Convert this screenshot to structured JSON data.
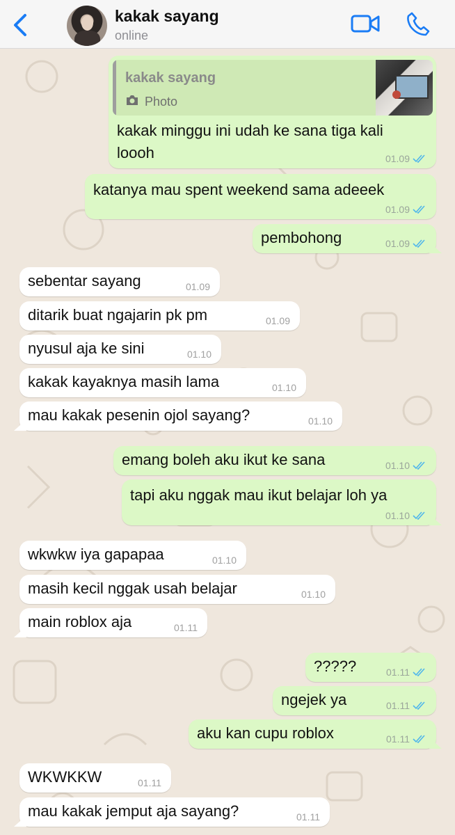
{
  "header": {
    "contact_name": "kakak sayang",
    "status": "online",
    "icons": [
      "back-chevron-icon",
      "video-call-icon",
      "phone-call-icon"
    ],
    "accent_color": "#1a7cf5"
  },
  "quoted": {
    "name": "kakak sayang",
    "type_label": "Photo"
  },
  "messages": [
    {
      "dir": "out",
      "text": "kakak minggu ini udah ke sana tiga kali",
      "text2": "loooh",
      "time": "01.09",
      "read": true,
      "reply_to": "photo"
    },
    {
      "dir": "out",
      "text": "katanya mau spent weekend sama adeeek",
      "time": "01.09",
      "read": true
    },
    {
      "dir": "out",
      "text": "pembohong",
      "time": "01.09",
      "read": true
    },
    {
      "dir": "in",
      "text": "sebentar sayang",
      "time": "01.09"
    },
    {
      "dir": "in",
      "text": "ditarik buat ngajarin pk pm",
      "time": "01.09"
    },
    {
      "dir": "in",
      "text": "nyusul aja ke sini",
      "time": "01.10"
    },
    {
      "dir": "in",
      "text": "kakak kayaknya masih lama",
      "time": "01.10"
    },
    {
      "dir": "in",
      "text": "mau kakak pesenin ojol sayang?",
      "time": "01.10"
    },
    {
      "dir": "out",
      "text": "emang boleh aku ikut ke sana",
      "time": "01.10",
      "read": true
    },
    {
      "dir": "out",
      "text": "tapi aku nggak mau ikut belajar loh ya",
      "time": "01.10",
      "read": true
    },
    {
      "dir": "in",
      "text": "wkwkw iya gapapaa",
      "time": "01.10"
    },
    {
      "dir": "in",
      "text": "masih kecil nggak usah belajar",
      "time": "01.10"
    },
    {
      "dir": "in",
      "text": "main roblox aja",
      "time": "01.11"
    },
    {
      "dir": "out",
      "text": "?????",
      "time": "01.11",
      "read": true
    },
    {
      "dir": "out",
      "text": "ngejek ya",
      "time": "01.11",
      "read": true
    },
    {
      "dir": "out",
      "text": "aku kan cupu roblox",
      "time": "01.11",
      "read": true
    },
    {
      "dir": "in",
      "text": "WKWKKW",
      "time": "01.11"
    },
    {
      "dir": "in",
      "text": "mau kakak jemput aja sayang?",
      "time": "01.11"
    }
  ]
}
